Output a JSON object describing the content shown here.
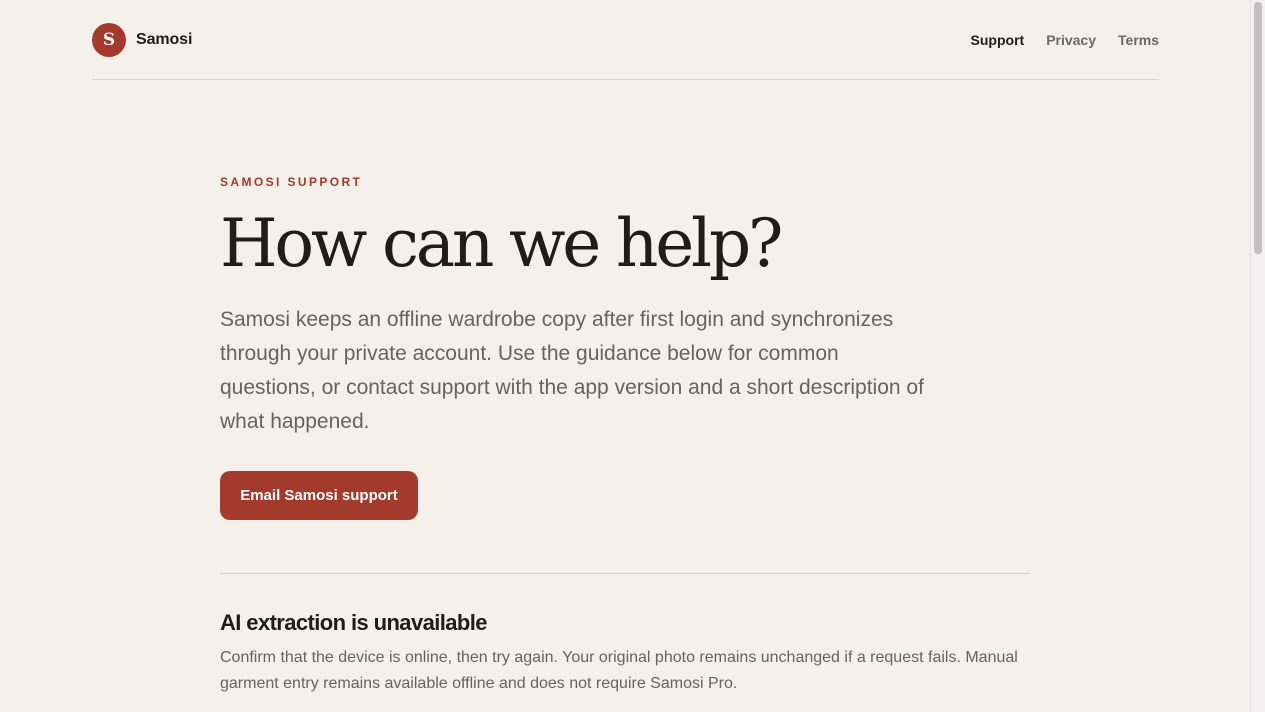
{
  "header": {
    "brand_initial": "S",
    "brand_name": "Samosi",
    "nav": [
      {
        "label": "Support",
        "active": true
      },
      {
        "label": "Privacy",
        "active": false
      },
      {
        "label": "Terms",
        "active": false
      }
    ]
  },
  "hero": {
    "eyebrow": "SAMOSI SUPPORT",
    "title": "How can we help?",
    "description": "Samosi keeps an offline wardrobe copy after first login and synchronizes through your private account. Use the guidance below for common questions, or contact support with the app version and a short description of what happened.",
    "cta_label": "Email Samosi support"
  },
  "faq": [
    {
      "title": "AI extraction is unavailable",
      "body": "Confirm that the device is online, then try again. Your original photo remains unchanged if a request fails. Manual garment entry remains available offline and does not require Samosi Pro."
    }
  ],
  "colors": {
    "background": "#f5f0ea",
    "accent": "#a33a2b",
    "text": "#1f1c19",
    "muted_text": "#6a635c"
  }
}
